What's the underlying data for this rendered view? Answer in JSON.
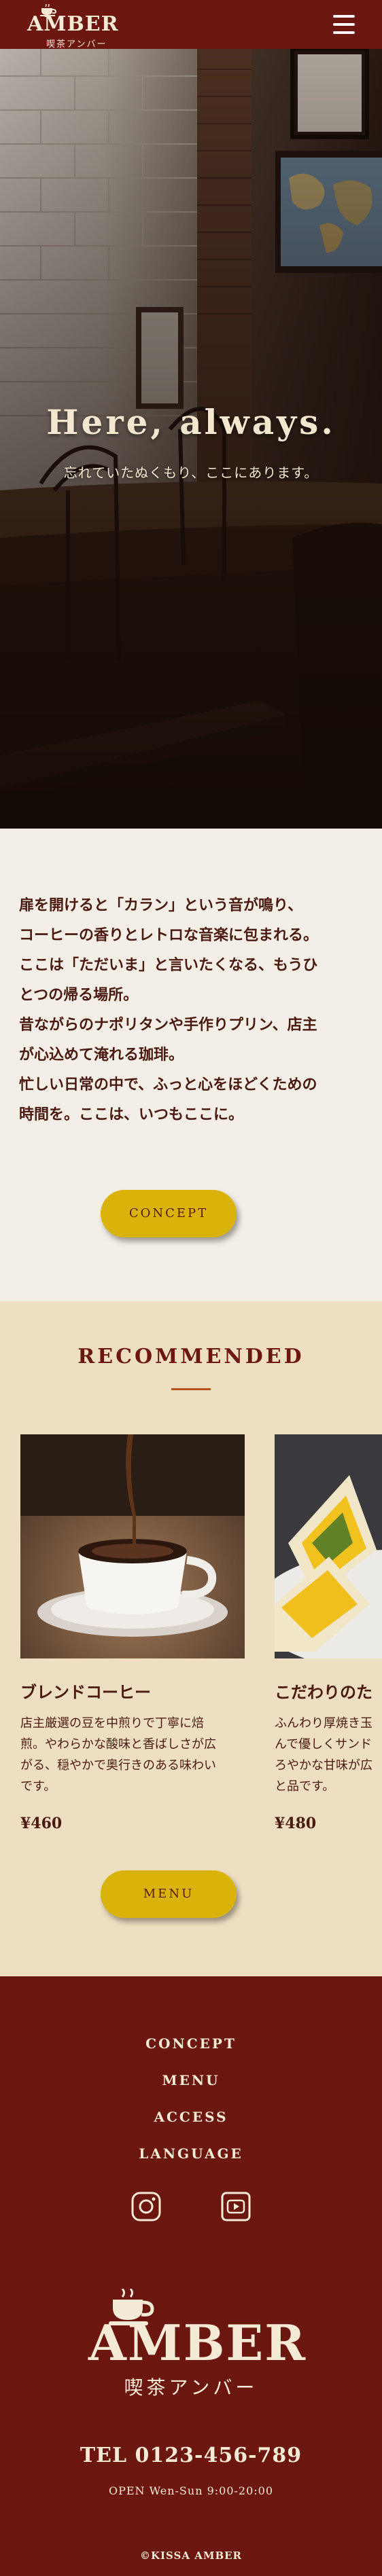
{
  "header": {
    "logo_text": "AMBER",
    "logo_sub": "喫茶アンバー",
    "menu_icon": "hamburger-icon"
  },
  "hero": {
    "title": "Here, always.",
    "subtitle": "忘れていたぬくもり、ここにあります。"
  },
  "intro": {
    "paragraphs": [
      "扉を開けると「カラン」という音が鳴り、",
      "コーヒーの香りとレトロな音楽に包まれる。",
      "ここは「ただいま」と言いたくなる、もうひ",
      "とつの帰る場所。",
      "昔ながらのナポリタンや手作りプリン、店主",
      "が心込めて淹れる珈琲。",
      "忙しい日常の中で、ふっと心をほどくための",
      "時間を。ここは、いつもここに。"
    ],
    "button_label": "CONCEPT"
  },
  "recommended": {
    "title": "RECOMMENDED",
    "items": [
      {
        "name": "ブレンドコーヒー",
        "desc_lines": [
          "店主厳選の豆を中煎りで丁寧に焙",
          "煎。やわらかな酸味と香ばしさが広",
          "がる、穏やかで奥行きのある味わい",
          "です。"
        ],
        "price": "¥460"
      },
      {
        "name": "こだわりのた",
        "desc_lines": [
          "ふんわり厚焼き玉",
          "んで優しくサンド",
          "ろやかな甘味が広",
          "と品です。"
        ],
        "price": "¥480"
      }
    ],
    "button_label": "MENU"
  },
  "footer": {
    "nav": [
      "CONCEPT",
      "MENU",
      "ACCESS",
      "LANGUAGE"
    ],
    "social_icons": [
      "instagram-icon",
      "youtube-icon"
    ],
    "logo_text": "AMBER",
    "logo_sub": "喫茶アンバー",
    "tel": "TEL 0123-456-789",
    "open": "OPEN Wen-Sun 9:00-20:00",
    "copyright": "©KISSA AMBER"
  },
  "colors": {
    "brand_dark_red": "#6b1710",
    "accent_gold": "#d9b30a",
    "cream": "#f4ead6",
    "intro_bg": "#f3efe7",
    "recommended_bg": "#efdfc2"
  }
}
